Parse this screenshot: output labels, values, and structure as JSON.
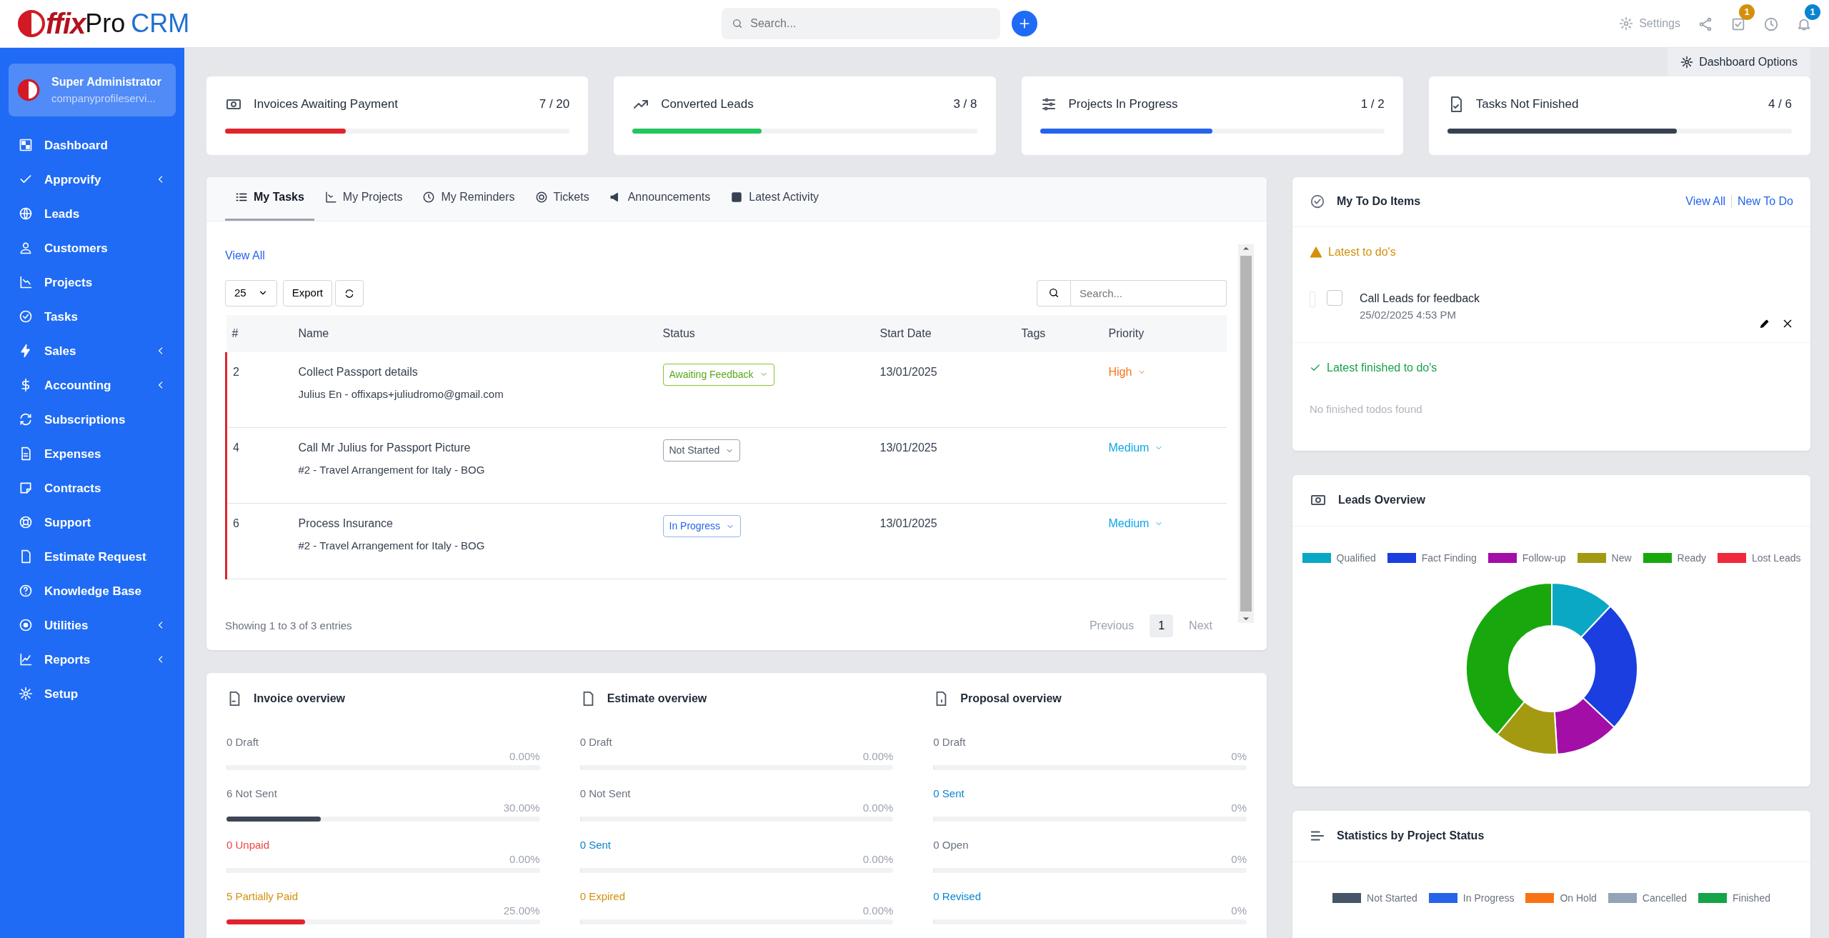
{
  "header": {
    "logo": {
      "part_1": "ffix",
      "part_2": "Pro",
      "part_3": "CRM"
    },
    "search": {
      "placeholder": "Search..."
    },
    "settings_label": "Settings",
    "todo_badge": "1",
    "notification_badge": "1"
  },
  "sidebar": {
    "profile": {
      "name": "Super Administrator",
      "email": "companyprofileservi..."
    },
    "items": [
      {
        "label": "Dashboard",
        "has_submenu": false
      },
      {
        "label": "Approvify",
        "has_submenu": true
      },
      {
        "label": "Leads",
        "has_submenu": false
      },
      {
        "label": "Customers",
        "has_submenu": false
      },
      {
        "label": "Projects",
        "has_submenu": false
      },
      {
        "label": "Tasks",
        "has_submenu": false
      },
      {
        "label": "Sales",
        "has_submenu": true
      },
      {
        "label": "Accounting",
        "has_submenu": true
      },
      {
        "label": "Subscriptions",
        "has_submenu": false
      },
      {
        "label": "Expenses",
        "has_submenu": false
      },
      {
        "label": "Contracts",
        "has_submenu": false
      },
      {
        "label": "Support",
        "has_submenu": false
      },
      {
        "label": "Estimate Request",
        "has_submenu": false
      },
      {
        "label": "Knowledge Base",
        "has_submenu": false
      },
      {
        "label": "Utilities",
        "has_submenu": true
      },
      {
        "label": "Reports",
        "has_submenu": true
      },
      {
        "label": "Setup",
        "has_submenu": false
      }
    ]
  },
  "dashboard_options": "Dashboard Options",
  "stats": [
    {
      "title": "Invoices Awaiting Payment",
      "value": "7 / 20",
      "level": 0.35,
      "color": "#e0242c"
    },
    {
      "title": "Converted Leads",
      "value": "3 / 8",
      "level": 0.375,
      "color": "#22c55e"
    },
    {
      "title": "Projects In Progress",
      "value": "1 / 2",
      "level": 0.5,
      "color": "#2563eb"
    },
    {
      "title": "Tasks Not Finished",
      "value": "4 / 6",
      "level": 0.667,
      "color": "#374151"
    }
  ],
  "tasks": {
    "tabs": [
      {
        "label": "My Tasks",
        "selected": true
      },
      {
        "label": "My Projects",
        "selected": false
      },
      {
        "label": "My Reminders",
        "selected": false
      },
      {
        "label": "Tickets",
        "selected": false
      },
      {
        "label": "Announcements",
        "selected": false
      },
      {
        "label": "Latest Activity",
        "selected": false
      }
    ],
    "view_all": "View All",
    "page_length": "25",
    "export": "Export",
    "search": {
      "placeholder": "Search..."
    },
    "columns": [
      "#",
      "Name",
      "Status",
      "Start Date",
      "Tags",
      "Priority"
    ],
    "rows": [
      {
        "id": "2",
        "name": "Collect Passport details",
        "detail": "Julius En - offixaps+juliudromo@gmail.com",
        "status": {
          "label": "Awaiting Feedback",
          "kind": "success"
        },
        "start_date": "13/01/2025",
        "priority": {
          "label": "High",
          "kind": "high"
        },
        "overdue": true
      },
      {
        "id": "4",
        "name": "Call Mr Julius for Passport Picture",
        "detail": "#2 - Travel Arrangement for Italy - BOG",
        "status": {
          "label": "Not Started",
          "kind": "default"
        },
        "start_date": "13/01/2025",
        "priority": {
          "label": "Medium",
          "kind": "medium"
        },
        "overdue": true
      },
      {
        "id": "6",
        "name": "Process Insurance",
        "detail": "#2 - Travel Arrangement for Italy - BOG",
        "status": {
          "label": "In Progress",
          "kind": "info"
        },
        "start_date": "13/01/2025",
        "priority": {
          "label": "Medium",
          "kind": "medium"
        },
        "overdue": true
      }
    ],
    "info": "Showing 1 to 3 of 3 entries",
    "pagination": {
      "previous": "Previous",
      "pages": [
        {
          "label": "1",
          "selected": true
        }
      ],
      "next": "Next"
    }
  },
  "overview": [
    {
      "title": "Invoice overview",
      "rows": [
        {
          "label": "0 Draft",
          "percent": "0.00%",
          "level": 0,
          "kind": "muted"
        },
        {
          "label": "6 Not Sent",
          "percent": "30.00%",
          "level": 0.3,
          "kind": "muted",
          "color": "#3f4756"
        },
        {
          "label": "0 Unpaid",
          "percent": "0.00%",
          "level": 0,
          "kind": "danger"
        },
        {
          "label": "5 Partially Paid",
          "percent": "25.00%",
          "level": 0.25,
          "kind": "warning",
          "color": "#e0242c"
        }
      ]
    },
    {
      "title": "Estimate overview",
      "rows": [
        {
          "label": "0 Draft",
          "percent": "0.00%",
          "level": 0,
          "kind": "muted"
        },
        {
          "label": "0 Not Sent",
          "percent": "0.00%",
          "level": 0,
          "kind": "muted"
        },
        {
          "label": "0 Sent",
          "percent": "0.00%",
          "level": 0,
          "kind": "info"
        },
        {
          "label": "0 Expired",
          "percent": "0.00%",
          "level": 0,
          "kind": "warning"
        }
      ]
    },
    {
      "title": "Proposal overview",
      "rows": [
        {
          "label": "0 Draft",
          "percent": "0%",
          "level": 0,
          "kind": "muted"
        },
        {
          "label": "0 Sent",
          "percent": "0%",
          "level": 0,
          "kind": "info"
        },
        {
          "label": "0 Open",
          "percent": "0%",
          "level": 0,
          "kind": "muted"
        },
        {
          "label": "0 Revised",
          "percent": "0%",
          "level": 0,
          "kind": "info"
        }
      ]
    }
  ],
  "todo": {
    "title": "My To Do Items",
    "view_all": "View All",
    "new_todo": "New To Do",
    "latest_heading": "Latest to do's",
    "items": [
      {
        "text": "Call Leads for feedback",
        "date": "25/02/2025 4:53 PM",
        "checked": false
      }
    ],
    "finished_heading": "Latest finished to do's",
    "finished_empty": "No finished todos found"
  },
  "leads_overview": {
    "title": "Leads Overview",
    "legend": [
      {
        "label": "Qualified",
        "color": "#0aa8c4"
      },
      {
        "label": "Fact Finding",
        "color": "#1a3ee0"
      },
      {
        "label": "Follow-up",
        "color": "#a30ea6"
      },
      {
        "label": "New",
        "color": "#a39a12"
      },
      {
        "label": "Ready",
        "color": "#18a80e"
      },
      {
        "label": "Lost Leads",
        "color": "#f0283c"
      }
    ]
  },
  "project_stats": {
    "title": "Statistics by Project Status",
    "legend": [
      {
        "label": "Not Started",
        "color": "#475569"
      },
      {
        "label": "In Progress",
        "color": "#2563eb"
      },
      {
        "label": "On Hold",
        "color": "#f97316"
      },
      {
        "label": "Cancelled",
        "color": "#94a3b8"
      },
      {
        "label": "Finished",
        "color": "#16a34a"
      }
    ]
  }
}
